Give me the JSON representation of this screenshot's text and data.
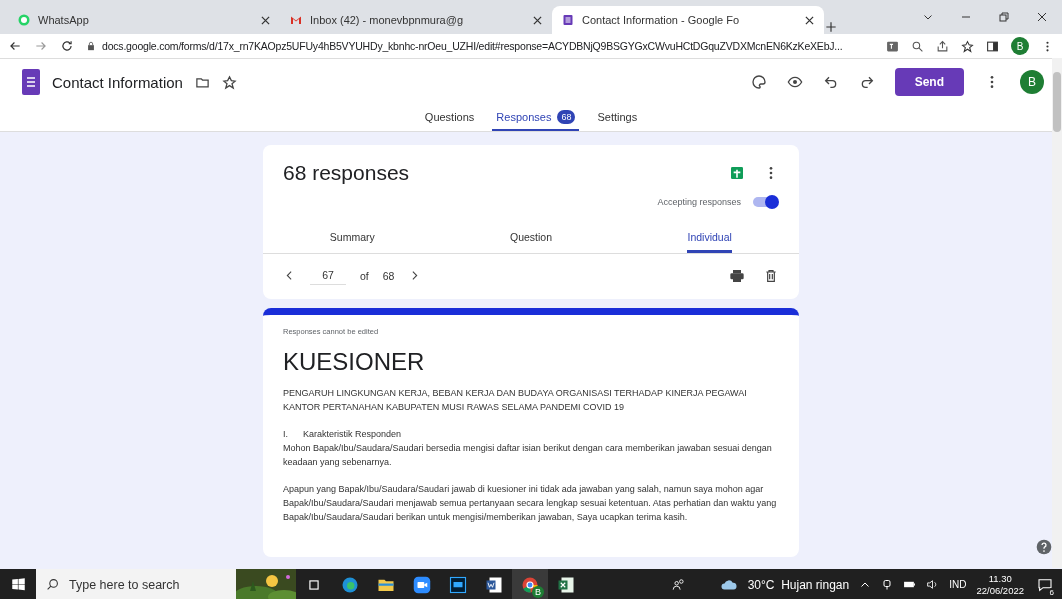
{
  "browser": {
    "tabs": [
      {
        "title": "WhatsApp",
        "selected": false
      },
      {
        "title": "Inbox (42) - monevbpnmura@g",
        "selected": false
      },
      {
        "title": "Contact Information - Google Fo",
        "selected": true
      }
    ],
    "url": "docs.google.com/forms/d/17x_rn7KAOpz5UFUy4hB5VYUHDy_kbnhc-nrOeu_UZHI/edit#response=ACYDBNjQ9BSGYGxCWvuHCtDGquZVDXMcnEN6KzKeXEbJ...",
    "profile": "B"
  },
  "form_header": {
    "title": "Contact Information",
    "send": "Send",
    "avatar": "B"
  },
  "nav_tabs": [
    {
      "label": "Questions",
      "selected": false
    },
    {
      "label": "Responses",
      "badge": "68",
      "selected": true
    },
    {
      "label": "Settings",
      "selected": false
    }
  ],
  "responses_card": {
    "title": "68 responses",
    "accepting_label": "Accepting responses",
    "accepting": true,
    "view_tabs": [
      {
        "label": "Summary",
        "selected": false
      },
      {
        "label": "Question",
        "selected": false
      },
      {
        "label": "Individual",
        "selected": true
      }
    ],
    "pager": {
      "current": "67",
      "of": "of",
      "total": "68"
    }
  },
  "response": {
    "notice": "Responses cannot be edited",
    "title": "KUESIONER",
    "paragraphs": [
      "PENGARUH LINGKUNGAN KERJA, BEBAN KERJA DAN BUDAYA ORGANISASI TERHADAP KINERJA PEGAWAI KANTOR PERTANAHAN KABUPATEN MUSI RAWAS SELAMA PANDEMI COVID 19",
      "I.      Karakteristik Responden\nMohon Bapak/Ibu/Saudara/Saudari bersedia mengisi daftar isian berikut dengan cara memberikan jawaban sesuai dengan keadaan yang sebenarnya.",
      "Apapun yang Bapak/Ibu/Saudara/Saudari jawab di kuesioner ini tidak ada jawaban yang salah, namun saya mohon agar Bapak/Ibu/Saudara/Saudari menjawab semua pertanyaan secara lengkap sesuai ketentuan. Atas perhatian dan waktu yang Bapak/Ibu/Saudara/Saudari berikan untuk mengisi/memberikan jawaban, Saya ucapkan terima kasih."
    ]
  },
  "taskbar": {
    "search_placeholder": "Type here to search",
    "chrome_badge": "B",
    "weather": "30°C  Hujan ringan",
    "language": "IND",
    "time": "11.30",
    "date": "22/06/2022",
    "notifications": "6"
  }
}
